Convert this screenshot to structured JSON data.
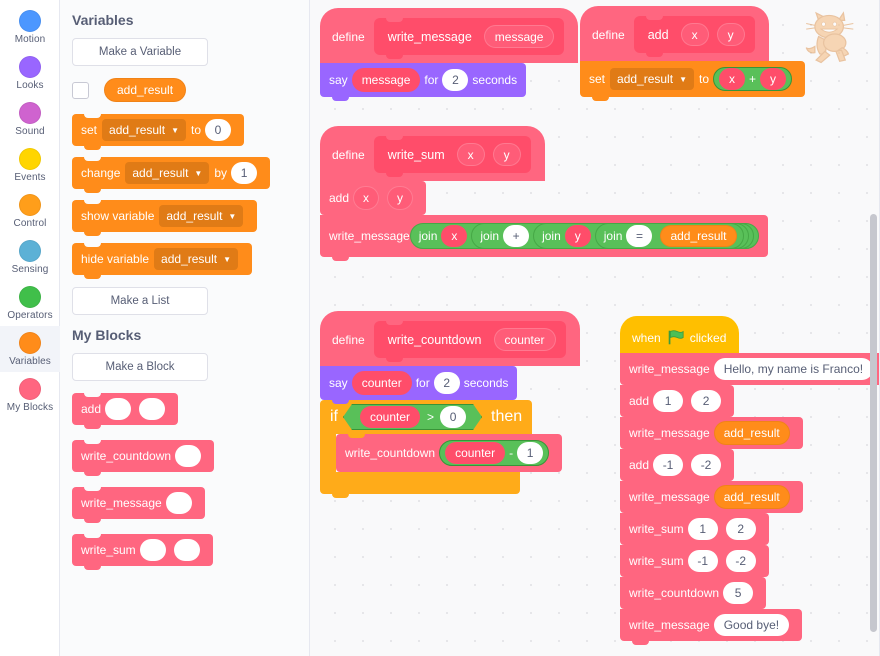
{
  "categories": [
    {
      "label": "Motion",
      "color": "#4c97ff",
      "selected": false
    },
    {
      "label": "Looks",
      "color": "#9966ff",
      "selected": false
    },
    {
      "label": "Sound",
      "color": "#cf63cf",
      "selected": false
    },
    {
      "label": "Events",
      "color": "#ffd500",
      "selected": false
    },
    {
      "label": "Control",
      "color": "#ff9e1a",
      "selected": false
    },
    {
      "label": "Sensing",
      "color": "#5cb1d6",
      "selected": false
    },
    {
      "label": "Operators",
      "color": "#40bf4a",
      "selected": false
    },
    {
      "label": "Variables",
      "color": "#ff8c1a",
      "selected": true
    },
    {
      "label": "My Blocks",
      "color": "#ff6680",
      "selected": false
    }
  ],
  "palette": {
    "variables_heading": "Variables",
    "make_variable_label": "Make a Variable",
    "variable_name": "add_result",
    "make_list_label": "Make a List",
    "myblocks_heading": "My Blocks",
    "make_block_label": "Make a Block",
    "set_label": "set",
    "set_to": "to",
    "set_value": "0",
    "change_label": "change",
    "change_by": "by",
    "change_value": "1",
    "show_variable_label": "show variable",
    "hide_variable_label": "hide variable",
    "custom_add": "add",
    "custom_write_countdown": "write_countdown",
    "custom_write_message": "write_message",
    "custom_write_sum": "write_sum"
  },
  "scripts": {
    "write_message_def": {
      "define": "define",
      "name": "write_message",
      "args": [
        "message"
      ],
      "say_label": "say",
      "say_arg": "message",
      "say_for": "for",
      "say_secs_value": "2",
      "say_seconds": "seconds"
    },
    "add_def": {
      "define": "define",
      "name": "add",
      "args": [
        "x",
        "y"
      ],
      "set_label": "set",
      "set_variable": "add_result",
      "set_to": "to",
      "operand_left": "x",
      "operator": "+",
      "operand_right": "y"
    },
    "write_sum_def": {
      "define": "define",
      "name": "write_sum",
      "args": [
        "x",
        "y"
      ],
      "call_add": "add",
      "call_add_args": [
        "x",
        "y"
      ],
      "call_write_message": "write_message",
      "join_label": "join",
      "join1_a": "x",
      "join2_a": "+",
      "join3_a": "y",
      "join4_a": "=",
      "join4_b": "add_result"
    },
    "write_countdown_def": {
      "define": "define",
      "name": "write_countdown",
      "args": [
        "counter"
      ],
      "say_label": "say",
      "say_arg": "counter",
      "say_for": "for",
      "say_secs_value": "2",
      "say_seconds": "seconds",
      "if_label": "if",
      "then_label": "then",
      "cond_left": "counter",
      "cond_op": ">",
      "cond_right": "0",
      "recurse_name": "write_countdown",
      "recurse_arg": "counter",
      "recurse_op": "-",
      "recurse_value": "1"
    },
    "main": {
      "hat_when": "when",
      "hat_flag_icon": "green-flag-icon",
      "hat_clicked": "clicked",
      "rows": [
        {
          "name": "write_message",
          "inputs": [
            {
              "type": "text",
              "value": "Hello, my name is Franco!"
            }
          ]
        },
        {
          "name": "add",
          "inputs": [
            {
              "type": "number",
              "value": "1"
            },
            {
              "type": "number",
              "value": "2"
            }
          ]
        },
        {
          "name": "write_message",
          "inputs": [
            {
              "type": "var",
              "value": "add_result"
            }
          ]
        },
        {
          "name": "add",
          "inputs": [
            {
              "type": "number",
              "value": "-1"
            },
            {
              "type": "number",
              "value": "-2"
            }
          ]
        },
        {
          "name": "write_message",
          "inputs": [
            {
              "type": "var",
              "value": "add_result"
            }
          ]
        },
        {
          "name": "write_sum",
          "inputs": [
            {
              "type": "number",
              "value": "1"
            },
            {
              "type": "number",
              "value": "2"
            }
          ]
        },
        {
          "name": "write_sum",
          "inputs": [
            {
              "type": "number",
              "value": "-1"
            },
            {
              "type": "number",
              "value": "-2"
            }
          ]
        },
        {
          "name": "write_countdown",
          "inputs": [
            {
              "type": "number",
              "value": "5"
            }
          ]
        },
        {
          "name": "write_message",
          "inputs": [
            {
              "type": "text",
              "value": "Good bye!"
            }
          ]
        }
      ]
    }
  },
  "colors": {
    "variables": "#ff8c1a",
    "myblocks": "#ff6680",
    "looks": "#9966ff",
    "control": "#ffab19",
    "operators": "#59c059",
    "events": "#ffbf00",
    "canvas_bg": "#f9f9fa"
  }
}
